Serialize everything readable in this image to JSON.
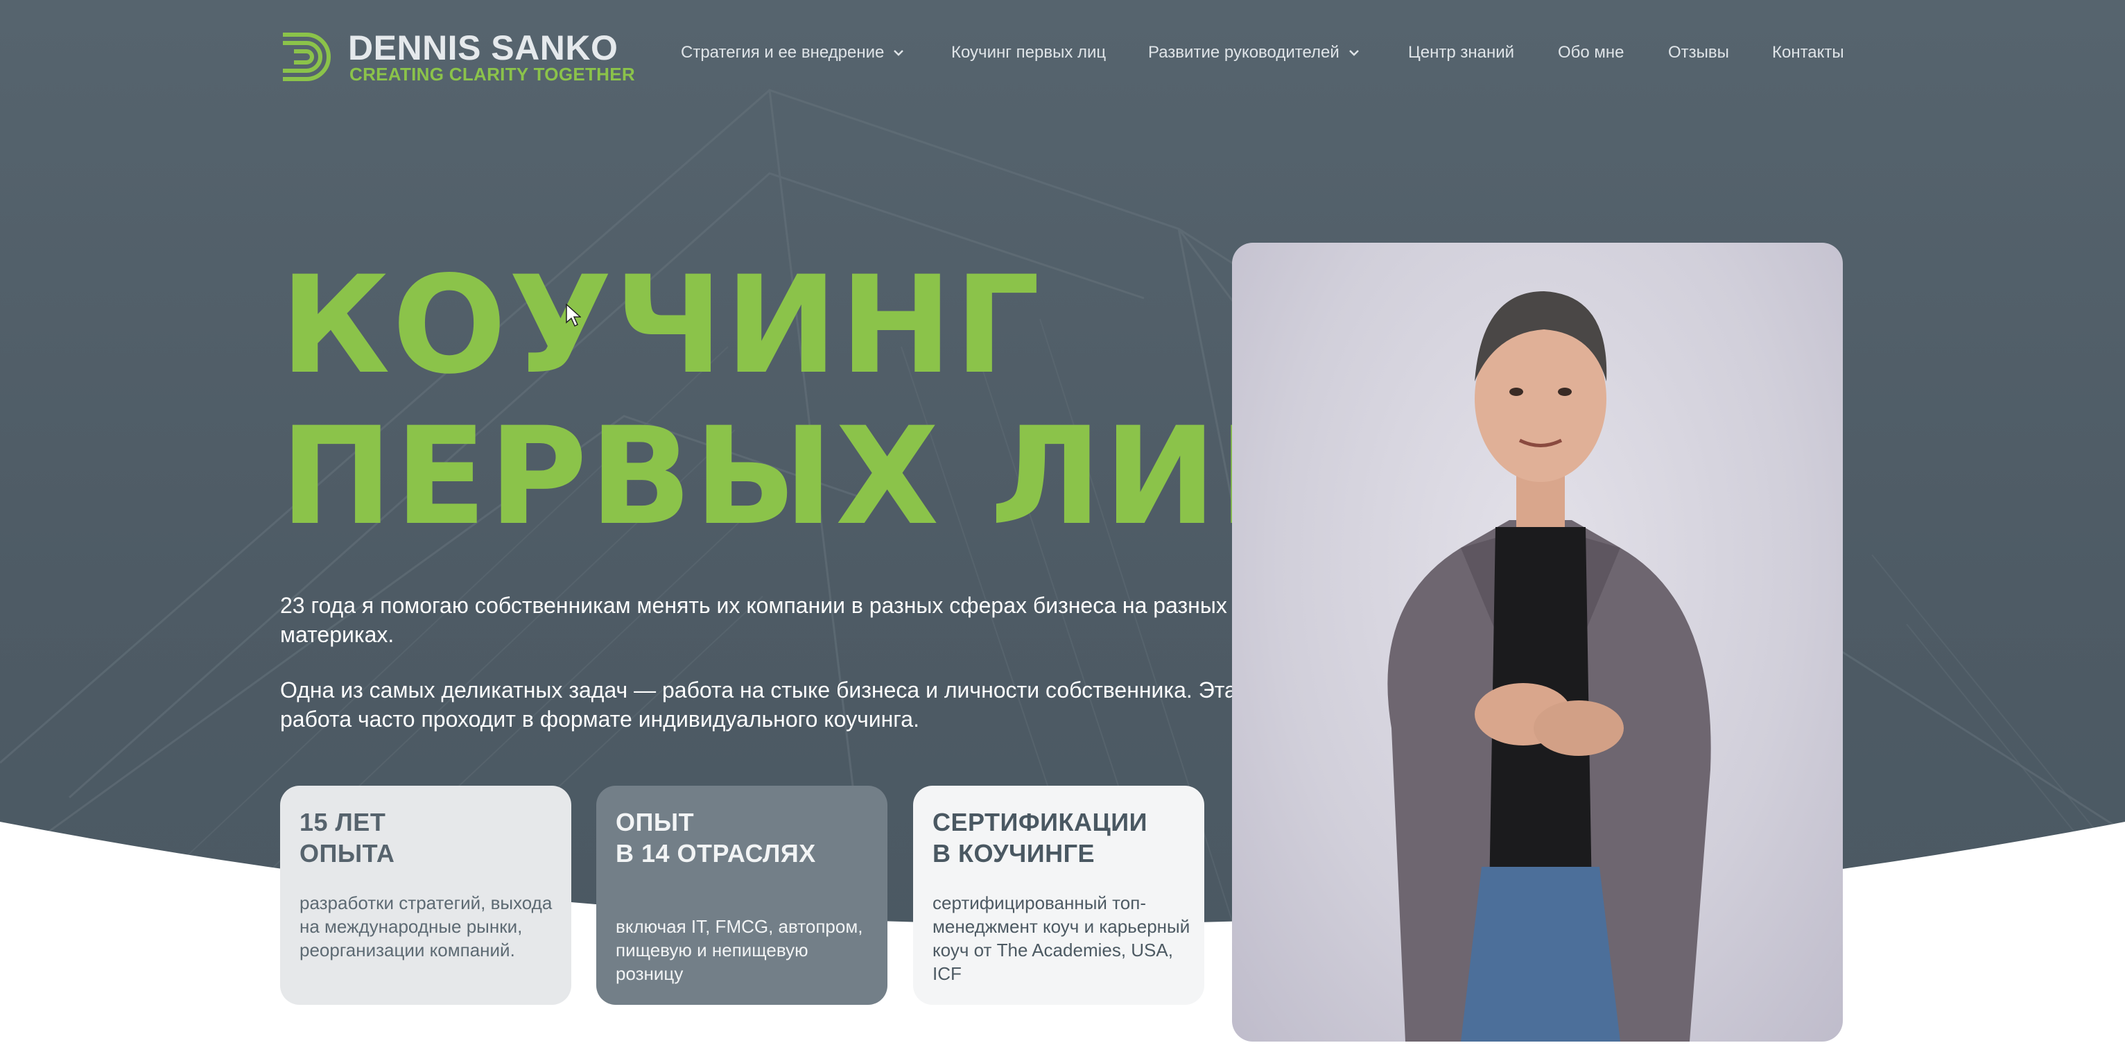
{
  "logo": {
    "name": "DENNIS SANKO",
    "tagline": "CREATING CLARITY TOGETHER",
    "mark_icon": "stylized-d-logo-icon"
  },
  "nav": {
    "items": [
      {
        "label": "Стратегия и ее внедрение",
        "has_dropdown": true
      },
      {
        "label": "Коучинг первых лиц",
        "has_dropdown": false
      },
      {
        "label": "Развитие руководителей",
        "has_dropdown": true
      },
      {
        "label": "Центр знаний",
        "has_dropdown": false
      },
      {
        "label": "Обо мне",
        "has_dropdown": false
      },
      {
        "label": "Отзывы",
        "has_dropdown": false
      },
      {
        "label": "Контакты",
        "has_dropdown": false
      }
    ]
  },
  "hero": {
    "title_line1": "КОУЧИНГ",
    "title_line2": "ПЕРВЫХ ЛИЦ",
    "paragraph1": "23 года я помогаю собственникам менять их компании в разных сферах бизнеса на разных материках.",
    "paragraph2": "Одна из самых деликатных задач — работа на стыке бизнеса и личности собственника. Эта работа часто проходит в формате индивидуального коучинга."
  },
  "cards": [
    {
      "title_line1": "15 ЛЕТ",
      "title_line2": "ОПЫТА",
      "text": "разработки стратегий, выхода на международные рынки, реорганизации компаний."
    },
    {
      "title_line1": "ОПЫТ",
      "title_line2": "В 14 ОТРАСЛЯХ",
      "text": "включая IT, FMCG, автопром, пищевую и непищевую розницу"
    },
    {
      "title_line1": "СЕРТИФИКАЦИИ",
      "title_line2": "В КОУЧИНГЕ",
      "text": "сертифицированный топ-менеджмент коуч и карьерный коуч от The Academies, USA, ICF"
    }
  ],
  "colors": {
    "accent_green": "#8bc34a",
    "hero_bg": "#4f5d67",
    "white": "#ffffff"
  }
}
